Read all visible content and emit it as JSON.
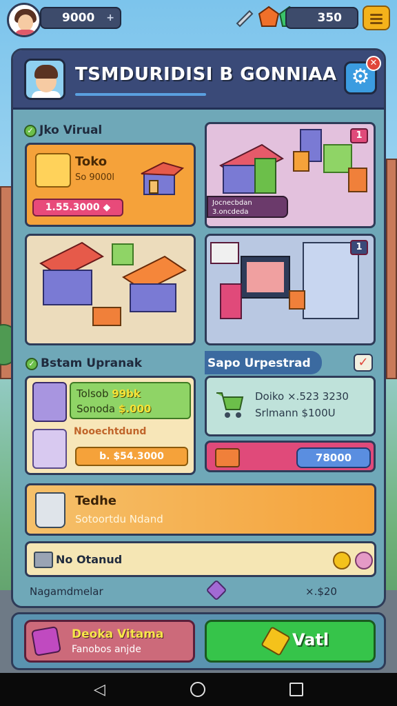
{
  "topbar": {
    "coins": "9000",
    "gems": "350"
  },
  "header": {
    "title": "TSMDURIDISI B GONNIAA"
  },
  "toko_virtual": {
    "label": "Jko Virual",
    "card": {
      "name": "Toko",
      "sub": "So 9000l",
      "price": "1.55.3000"
    }
  },
  "scenes": {
    "top_right_badge": "1",
    "top_right_caption": "Jocnecbdan 3.oncdeda",
    "mid_right_badge": "1"
  },
  "bstam": {
    "label": "Bstam Upranak",
    "line1": "Tolsob",
    "line1_value": "99bk",
    "line2": "Sonoda",
    "line2_value": "$.000",
    "orange_label": "Nooechtdund",
    "price": "b. $54.3000"
  },
  "sapo": {
    "label": "Sapo Urpestrad",
    "line1": "Doiko ×.523 3230",
    "line2": "Srlmann $100U",
    "pill": "78000"
  },
  "teh": {
    "name": "Tedhe",
    "sub": "Sotoortdu Ndand"
  },
  "mo": {
    "text": "No Otanud"
  },
  "footer": {
    "left": "Nagamdmelar",
    "right": "×.$20"
  },
  "bottom": {
    "deck_title": "Deoka Vitama",
    "deck_sub": "Fanobos anjde",
    "vati_label": "Vatl"
  },
  "colors": {
    "accent_green": "#36c44a",
    "accent_orange": "#f5a23a",
    "accent_pink": "#e04a7a",
    "header_navy": "#3a4a78"
  }
}
